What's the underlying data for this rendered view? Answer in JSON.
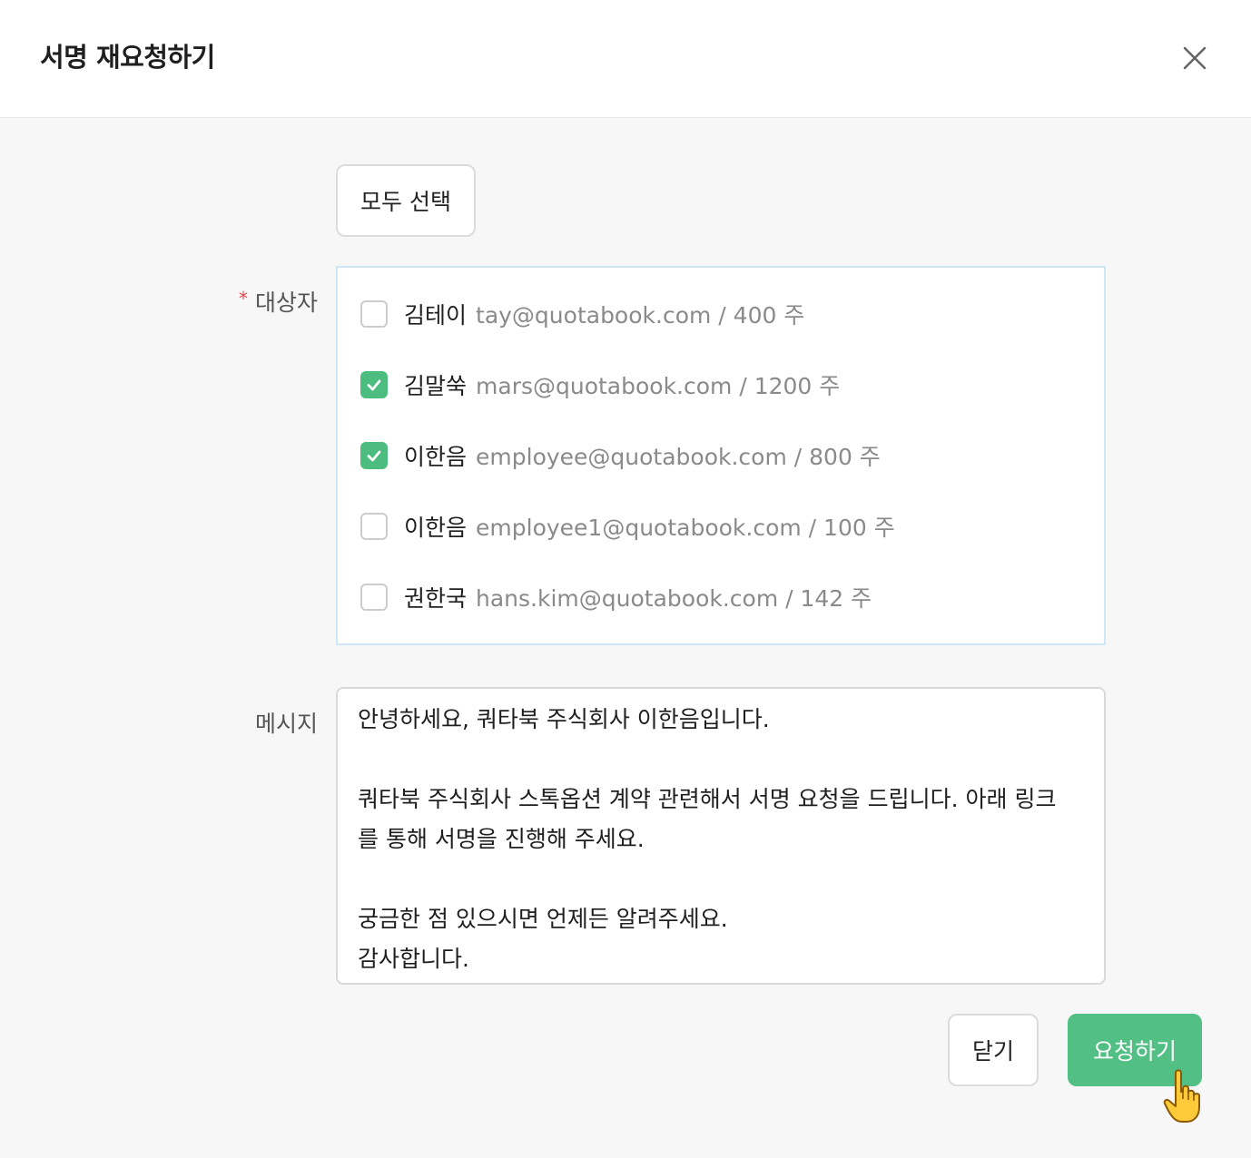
{
  "header": {
    "title": "서명 재요청하기"
  },
  "actions": {
    "select_all_label": "모두 선택",
    "close_label": "닫기",
    "request_label": "요청하기"
  },
  "recipients": {
    "label": "대상자",
    "required_mark": "*",
    "items": [
      {
        "name": "김테이",
        "detail": "tay@quotabook.com / 400 주",
        "checked": false
      },
      {
        "name": "김말쑥",
        "detail": "mars@quotabook.com / 1200 주",
        "checked": true
      },
      {
        "name": "이한음",
        "detail": "employee@quotabook.com / 800 주",
        "checked": true
      },
      {
        "name": "이한음",
        "detail": "employee1@quotabook.com / 100 주",
        "checked": false
      },
      {
        "name": "권한국",
        "detail": "hans.kim@quotabook.com / 142 주",
        "checked": false
      }
    ]
  },
  "message": {
    "label": "메시지",
    "lines": [
      "안녕하세요, 쿼타북 주식회사 이한음입니다.",
      "",
      "쿼타북 주식회사 스톡옵션 계약 관련해서 서명 요청을 드립니다. 아래 링크",
      "를 통해 서명을 진행해 주세요.",
      "",
      "궁금한 점 있으시면 언제든 알려주세요.",
      "감사합니다."
    ]
  },
  "colors": {
    "accent": "#52c084",
    "checkbox_checked": "#4cbd7f",
    "required": "#e5484d",
    "recipients_border": "#cfe6f7"
  }
}
